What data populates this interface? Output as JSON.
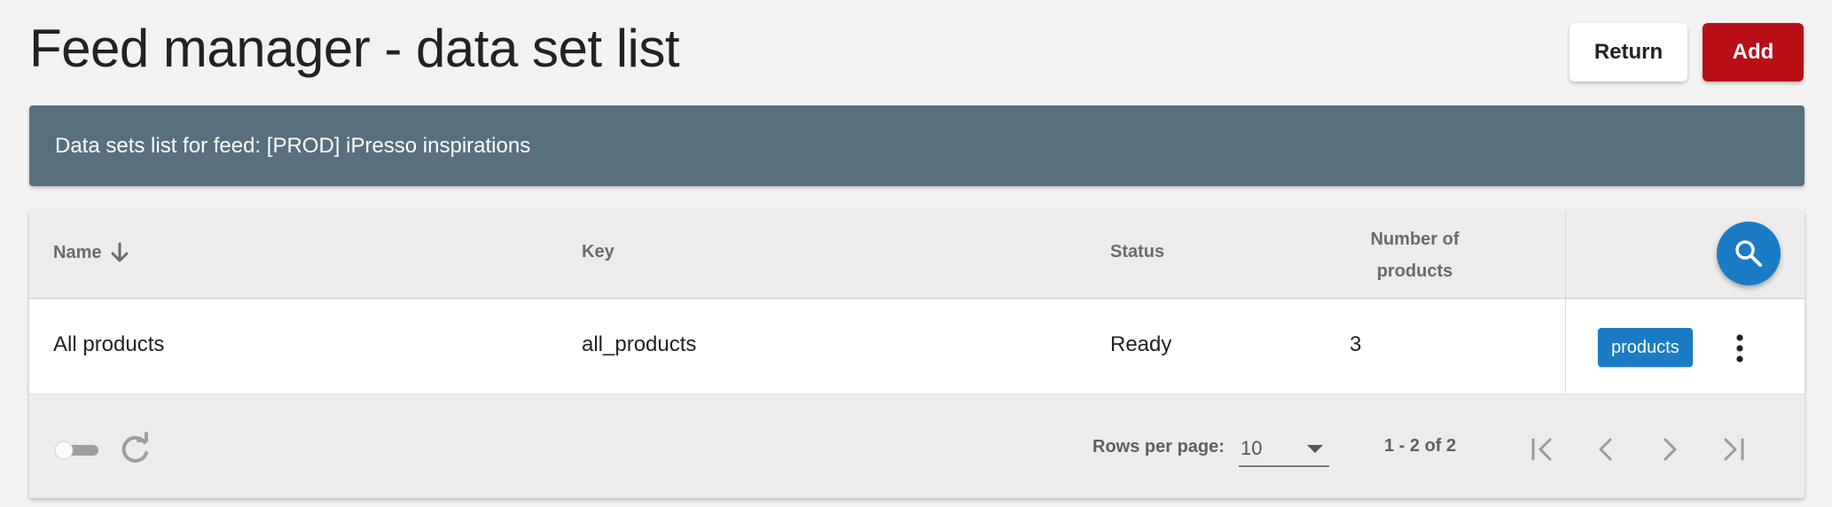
{
  "header": {
    "title": "Feed manager - data set list",
    "return_label": "Return",
    "add_label": "Add"
  },
  "banner": {
    "text": "Data sets list for feed: [PROD] iPresso inspirations"
  },
  "table": {
    "columns": {
      "name": "Name",
      "key": "Key",
      "status": "Status",
      "number_line1": "Number of",
      "number_line2": "products"
    },
    "sort_icon": "arrow-down-icon",
    "search_icon": "search-icon",
    "rows": [
      {
        "name": "All products",
        "key": "all_products",
        "status": "Ready",
        "number": "3",
        "chip": "products"
      }
    ]
  },
  "footer": {
    "rows_per_page_label": "Rows per page:",
    "rows_per_page_value": "10",
    "range_text": "1 - 2 of 2",
    "icons": [
      "toggle-icon",
      "refresh-icon",
      "first-page-icon",
      "prev-page-icon",
      "next-page-icon",
      "last-page-icon"
    ]
  },
  "colors": {
    "background": "#f2f2f2",
    "add_button": "#b80f17",
    "banner": "#58707d",
    "accent_blue": "#1b7cc5",
    "table_header": "#ececec"
  }
}
